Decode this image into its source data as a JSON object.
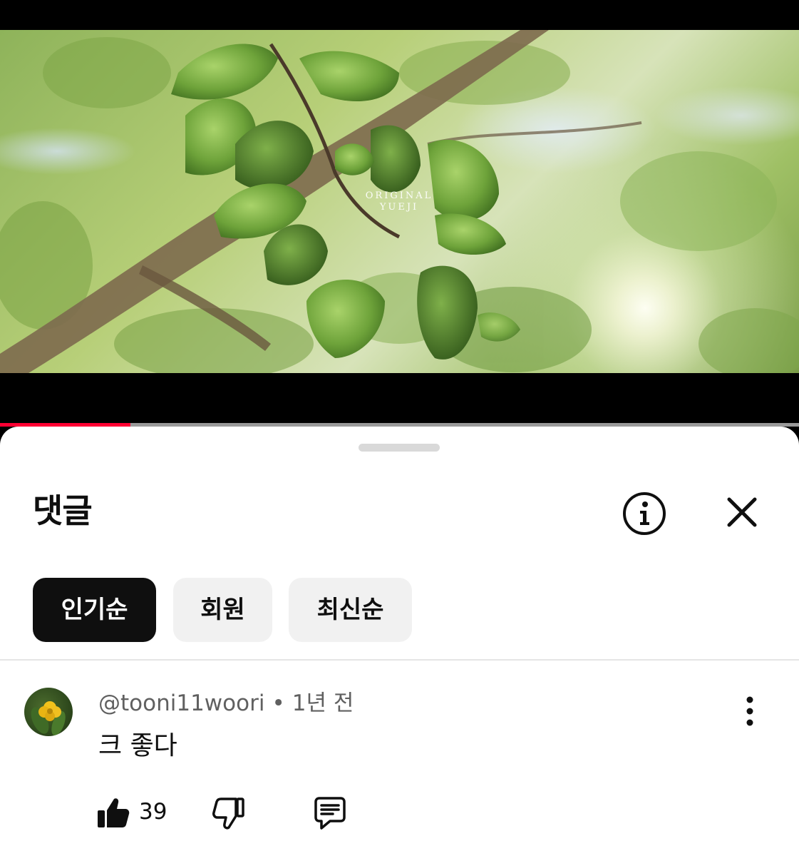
{
  "video": {
    "watermark_line1": "ORIGINAL",
    "watermark_line2": "YUEJI",
    "progress_fraction": 0.163,
    "progress_color": "#ff0033"
  },
  "comments_panel": {
    "title": "댓글",
    "info_icon": "info-circle-icon",
    "close_icon": "close-icon",
    "sort_chips": [
      {
        "label": "인기순",
        "active": true
      },
      {
        "label": "회원",
        "active": false
      },
      {
        "label": "최신순",
        "active": false
      }
    ]
  },
  "comments": [
    {
      "author": "@tooni11woori",
      "separator": "•",
      "time": "1년 전",
      "text": "크 좋다",
      "like_count": "39",
      "icons": [
        "thumb-up-icon",
        "thumb-down-icon",
        "reply-icon",
        "more-vert-icon"
      ]
    }
  ]
}
